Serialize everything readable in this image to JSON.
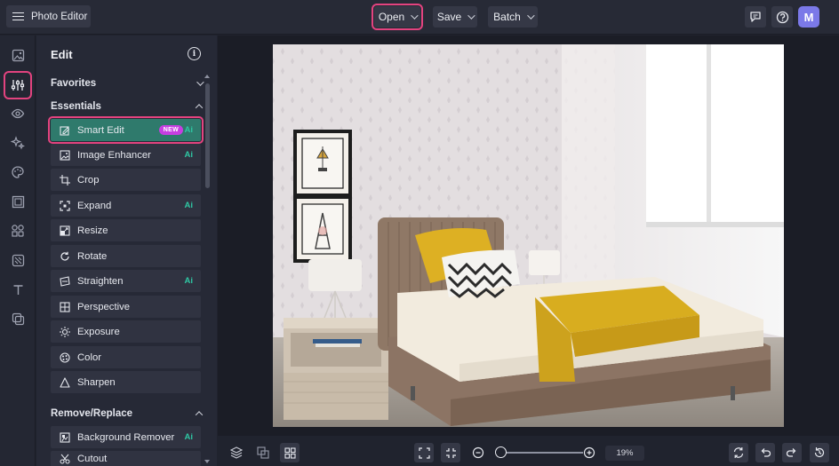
{
  "header": {
    "app_title": "Photo Editor",
    "menus": [
      {
        "label": "Open"
      },
      {
        "label": "Save"
      },
      {
        "label": "Batch"
      }
    ],
    "avatar_initial": "M"
  },
  "rail": {
    "icons": [
      "image-icon",
      "sliders-icon",
      "eye-icon",
      "sparkles-icon",
      "palette-icon",
      "frame-icon",
      "shapes-icon",
      "texture-icon",
      "text-icon",
      "overlay-icon"
    ],
    "active_index": 1
  },
  "panel": {
    "title": "Edit",
    "sections": {
      "favorites": "Favorites",
      "essentials": "Essentials",
      "remove_replace": "Remove/Replace"
    },
    "tools": [
      {
        "label": "Smart Edit",
        "badge": "NEW",
        "ai": "Ai",
        "icon": "smart-edit-icon"
      },
      {
        "label": "Image Enhancer",
        "ai": "Ai",
        "icon": "enhancer-icon"
      },
      {
        "label": "Crop",
        "icon": "crop-icon"
      },
      {
        "label": "Expand",
        "ai": "Ai",
        "icon": "expand-icon"
      },
      {
        "label": "Resize",
        "icon": "resize-icon"
      },
      {
        "label": "Rotate",
        "icon": "rotate-icon"
      },
      {
        "label": "Straighten",
        "ai": "Ai",
        "icon": "straighten-icon"
      },
      {
        "label": "Perspective",
        "icon": "perspective-icon"
      },
      {
        "label": "Exposure",
        "icon": "exposure-icon"
      },
      {
        "label": "Color",
        "icon": "color-icon"
      },
      {
        "label": "Sharpen",
        "icon": "sharpen-icon"
      }
    ],
    "remove_tools": [
      {
        "label": "Background Remover",
        "ai": "Ai",
        "icon": "background-remover-icon"
      },
      {
        "label": "Cutout",
        "icon": "cutout-icon"
      }
    ]
  },
  "canvas": {
    "zoom_level": "19%",
    "zoom_fraction": 0.03
  },
  "colors": {
    "accent_highlight": "#e3437f",
    "active_tool": "#2f7a6c",
    "ai_tag": "#2fc7a3",
    "new_badge": "#c63fe0",
    "avatar": "#7b79e8"
  }
}
